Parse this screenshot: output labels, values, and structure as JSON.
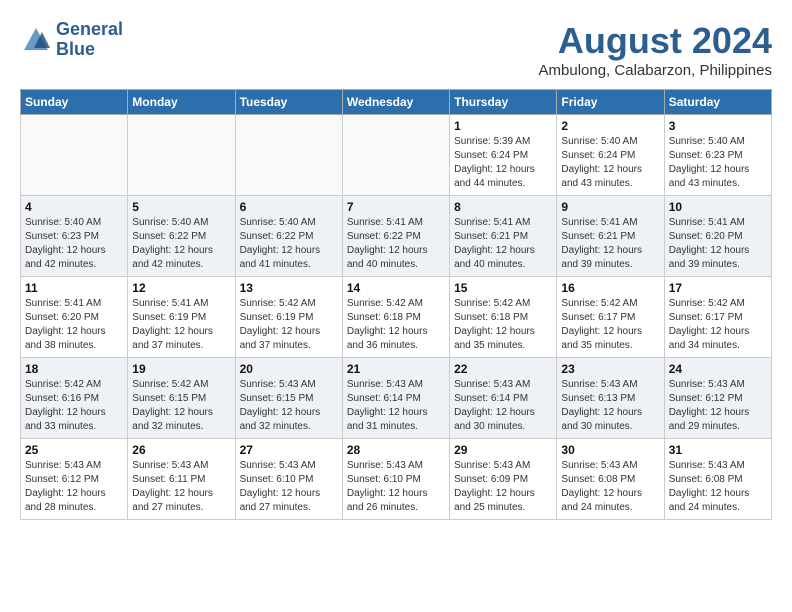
{
  "header": {
    "logo_line1": "General",
    "logo_line2": "Blue",
    "month_title": "August 2024",
    "location": "Ambulong, Calabarzon, Philippines"
  },
  "weekdays": [
    "Sunday",
    "Monday",
    "Tuesday",
    "Wednesday",
    "Thursday",
    "Friday",
    "Saturday"
  ],
  "weeks": [
    [
      {
        "day": "",
        "info": ""
      },
      {
        "day": "",
        "info": ""
      },
      {
        "day": "",
        "info": ""
      },
      {
        "day": "",
        "info": ""
      },
      {
        "day": "1",
        "info": "Sunrise: 5:39 AM\nSunset: 6:24 PM\nDaylight: 12 hours\nand 44 minutes."
      },
      {
        "day": "2",
        "info": "Sunrise: 5:40 AM\nSunset: 6:24 PM\nDaylight: 12 hours\nand 43 minutes."
      },
      {
        "day": "3",
        "info": "Sunrise: 5:40 AM\nSunset: 6:23 PM\nDaylight: 12 hours\nand 43 minutes."
      }
    ],
    [
      {
        "day": "4",
        "info": "Sunrise: 5:40 AM\nSunset: 6:23 PM\nDaylight: 12 hours\nand 42 minutes."
      },
      {
        "day": "5",
        "info": "Sunrise: 5:40 AM\nSunset: 6:22 PM\nDaylight: 12 hours\nand 42 minutes."
      },
      {
        "day": "6",
        "info": "Sunrise: 5:40 AM\nSunset: 6:22 PM\nDaylight: 12 hours\nand 41 minutes."
      },
      {
        "day": "7",
        "info": "Sunrise: 5:41 AM\nSunset: 6:22 PM\nDaylight: 12 hours\nand 40 minutes."
      },
      {
        "day": "8",
        "info": "Sunrise: 5:41 AM\nSunset: 6:21 PM\nDaylight: 12 hours\nand 40 minutes."
      },
      {
        "day": "9",
        "info": "Sunrise: 5:41 AM\nSunset: 6:21 PM\nDaylight: 12 hours\nand 39 minutes."
      },
      {
        "day": "10",
        "info": "Sunrise: 5:41 AM\nSunset: 6:20 PM\nDaylight: 12 hours\nand 39 minutes."
      }
    ],
    [
      {
        "day": "11",
        "info": "Sunrise: 5:41 AM\nSunset: 6:20 PM\nDaylight: 12 hours\nand 38 minutes."
      },
      {
        "day": "12",
        "info": "Sunrise: 5:41 AM\nSunset: 6:19 PM\nDaylight: 12 hours\nand 37 minutes."
      },
      {
        "day": "13",
        "info": "Sunrise: 5:42 AM\nSunset: 6:19 PM\nDaylight: 12 hours\nand 37 minutes."
      },
      {
        "day": "14",
        "info": "Sunrise: 5:42 AM\nSunset: 6:18 PM\nDaylight: 12 hours\nand 36 minutes."
      },
      {
        "day": "15",
        "info": "Sunrise: 5:42 AM\nSunset: 6:18 PM\nDaylight: 12 hours\nand 35 minutes."
      },
      {
        "day": "16",
        "info": "Sunrise: 5:42 AM\nSunset: 6:17 PM\nDaylight: 12 hours\nand 35 minutes."
      },
      {
        "day": "17",
        "info": "Sunrise: 5:42 AM\nSunset: 6:17 PM\nDaylight: 12 hours\nand 34 minutes."
      }
    ],
    [
      {
        "day": "18",
        "info": "Sunrise: 5:42 AM\nSunset: 6:16 PM\nDaylight: 12 hours\nand 33 minutes."
      },
      {
        "day": "19",
        "info": "Sunrise: 5:42 AM\nSunset: 6:15 PM\nDaylight: 12 hours\nand 32 minutes."
      },
      {
        "day": "20",
        "info": "Sunrise: 5:43 AM\nSunset: 6:15 PM\nDaylight: 12 hours\nand 32 minutes."
      },
      {
        "day": "21",
        "info": "Sunrise: 5:43 AM\nSunset: 6:14 PM\nDaylight: 12 hours\nand 31 minutes."
      },
      {
        "day": "22",
        "info": "Sunrise: 5:43 AM\nSunset: 6:14 PM\nDaylight: 12 hours\nand 30 minutes."
      },
      {
        "day": "23",
        "info": "Sunrise: 5:43 AM\nSunset: 6:13 PM\nDaylight: 12 hours\nand 30 minutes."
      },
      {
        "day": "24",
        "info": "Sunrise: 5:43 AM\nSunset: 6:12 PM\nDaylight: 12 hours\nand 29 minutes."
      }
    ],
    [
      {
        "day": "25",
        "info": "Sunrise: 5:43 AM\nSunset: 6:12 PM\nDaylight: 12 hours\nand 28 minutes."
      },
      {
        "day": "26",
        "info": "Sunrise: 5:43 AM\nSunset: 6:11 PM\nDaylight: 12 hours\nand 27 minutes."
      },
      {
        "day": "27",
        "info": "Sunrise: 5:43 AM\nSunset: 6:10 PM\nDaylight: 12 hours\nand 27 minutes."
      },
      {
        "day": "28",
        "info": "Sunrise: 5:43 AM\nSunset: 6:10 PM\nDaylight: 12 hours\nand 26 minutes."
      },
      {
        "day": "29",
        "info": "Sunrise: 5:43 AM\nSunset: 6:09 PM\nDaylight: 12 hours\nand 25 minutes."
      },
      {
        "day": "30",
        "info": "Sunrise: 5:43 AM\nSunset: 6:08 PM\nDaylight: 12 hours\nand 24 minutes."
      },
      {
        "day": "31",
        "info": "Sunrise: 5:43 AM\nSunset: 6:08 PM\nDaylight: 12 hours\nand 24 minutes."
      }
    ]
  ]
}
